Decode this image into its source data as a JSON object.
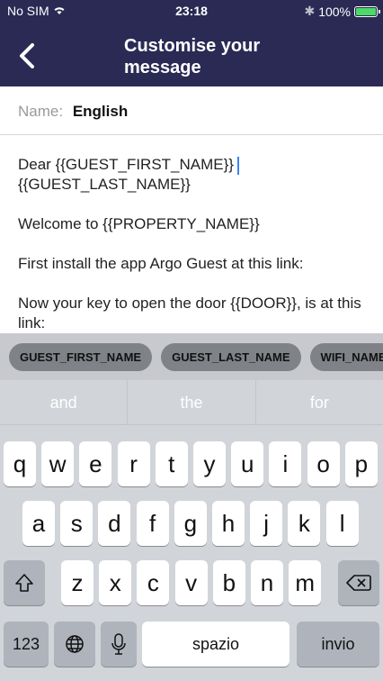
{
  "status": {
    "carrier": "No SIM",
    "time": "23:18",
    "bluetooth": "✱",
    "battery": "100%",
    "battery_level": 1.0
  },
  "header": {
    "title": "Customise your message",
    "back_icon": "chevron-left-icon"
  },
  "name": {
    "label": "Name:",
    "value": "English"
  },
  "message": {
    "line1": "Dear {{GUEST_FIRST_NAME}}",
    "line2": "{{GUEST_LAST_NAME}}",
    "welcome": "Welcome to {{PROPERTY_NAME}}",
    "install": "First install the app Argo Guest at this link:",
    "key": "Now your key to open the door {{DOOR}}, is at this link:"
  },
  "chips": [
    "GUEST_FIRST_NAME",
    "GUEST_LAST_NAME",
    "WIFI_NAME"
  ],
  "keyboard": {
    "suggestions": [
      "and",
      "the",
      "for"
    ],
    "row1": [
      "q",
      "w",
      "e",
      "r",
      "t",
      "y",
      "u",
      "i",
      "o",
      "p"
    ],
    "row2": [
      "a",
      "s",
      "d",
      "f",
      "g",
      "h",
      "j",
      "k",
      "l"
    ],
    "row3": [
      "z",
      "x",
      "c",
      "v",
      "b",
      "n",
      "m"
    ],
    "numbers_label": "123",
    "space_label": "spazio",
    "return_label": "invio"
  },
  "colors": {
    "header": "#2a2a55",
    "caret": "#3b82f6",
    "battery": "#4cd964"
  }
}
